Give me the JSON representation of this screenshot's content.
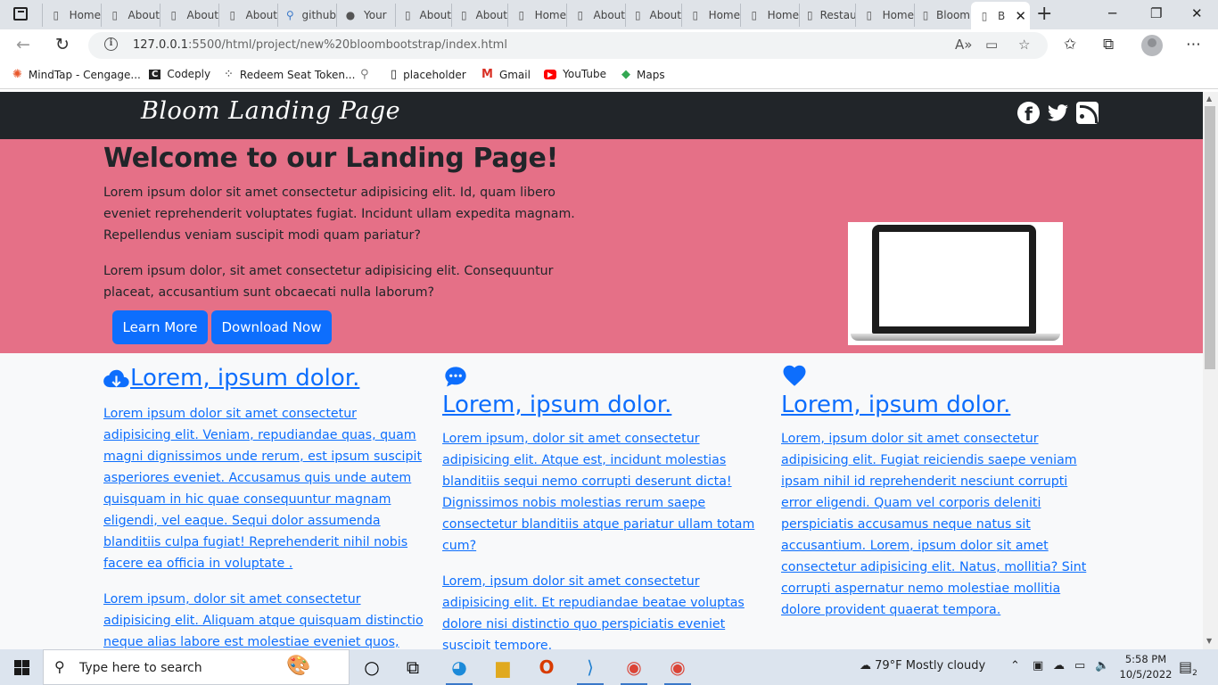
{
  "browser": {
    "tabs": [
      {
        "label": "Home",
        "icon": "page-icon"
      },
      {
        "label": "About",
        "icon": "page-icon"
      },
      {
        "label": "About",
        "icon": "page-icon"
      },
      {
        "label": "About",
        "icon": "page-icon"
      },
      {
        "label": "github",
        "icon": "search-icon"
      },
      {
        "label": "Your",
        "icon": "github-icon"
      },
      {
        "label": "About",
        "icon": "page-icon"
      },
      {
        "label": "About",
        "icon": "page-icon"
      },
      {
        "label": "Home",
        "icon": "page-icon"
      },
      {
        "label": "About",
        "icon": "page-icon"
      },
      {
        "label": "About",
        "icon": "page-icon"
      },
      {
        "label": "Home",
        "icon": "page-icon"
      },
      {
        "label": "Home",
        "icon": "page-icon"
      },
      {
        "label": "Restau",
        "icon": "page-icon"
      },
      {
        "label": "Home",
        "icon": "page-icon"
      },
      {
        "label": "Bloom",
        "icon": "page-icon"
      },
      {
        "label": "B",
        "icon": "page-icon",
        "active": true
      }
    ],
    "url_host": "127.0.0.1",
    "url_path": ":5500/html/project/new%20bloombootstrap/index.html"
  },
  "bookmarks": [
    {
      "label": "MindTap - Cengage...",
      "icon": "mindtap-icon"
    },
    {
      "label": "Codeply",
      "icon": "codeply-icon"
    },
    {
      "label": "Redeem Seat Token...",
      "icon": "dots-icon"
    },
    {
      "label": "",
      "icon": "search-icon"
    },
    {
      "label": "placeholder",
      "icon": "page-icon"
    },
    {
      "label": "Gmail",
      "icon": "gmail-icon"
    },
    {
      "label": "YouTube",
      "icon": "youtube-icon"
    },
    {
      "label": "Maps",
      "icon": "maps-icon"
    }
  ],
  "site": {
    "brand": "Bloom Landing Page",
    "hero": {
      "title": "Welcome to our Landing Page!",
      "paragraph1": "Lorem ipsum dolor sit amet consectetur adipisicing elit. Id, quam libero eveniet reprehenderit voluptates fugiat. Incidunt ullam expedita magnam. Repellendus veniam suscipit modi quam pariatur?",
      "paragraph2": "Lorem ipsum dolor, sit amet consectetur adipisicing elit. Consequuntur placeat, accusantium sunt obcaecati nulla laborum?",
      "learn_more": "Learn More",
      "download_now": "Download Now"
    },
    "features": [
      {
        "icon": "cloud-download-icon",
        "title": "Lorem, ipsum dolor.",
        "paragraphs": [
          "Lorem ipsum dolor sit amet consectetur adipisicing elit. Veniam, repudiandae quas, quam magni dignissimos unde rerum, est ipsum suscipit asperiores eveniet. Accusamus quis unde autem quisquam in hic quae consequuntur magnam eligendi, vel eaque. Sequi dolor assumenda blanditiis culpa fugiat! Reprehenderit nihil nobis facere ea officia in voluptate .",
          "Lorem ipsum, dolor sit amet consectetur adipisicing elit. Aliquam atque quisquam distinctio neque alias labore est molestiae eveniet quos,"
        ]
      },
      {
        "icon": "chat-icon",
        "title": "Lorem, ipsum dolor.",
        "paragraphs": [
          "Lorem ipsum, dolor sit amet consectetur adipisicing elit. Atque est, incidunt molestias blanditiis sequi nemo corrupti deserunt dicta! Dignissimos nobis molestias rerum saepe consectetur blanditiis atque pariatur ullam totam cum?",
          "Lorem, ipsum dolor sit amet consectetur adipisicing elit. Et repudiandae beatae voluptas dolore nisi distinctio quo perspiciatis eveniet suscipit tempore."
        ]
      },
      {
        "icon": "heart-icon",
        "title": "Lorem, ipsum dolor.",
        "paragraphs": [
          "Lorem, ipsum dolor sit amet consectetur adipisicing elit. Fugiat reiciendis saepe veniam ipsam nihil id reprehenderit nesciunt corrupti error eligendi. Quam vel corporis deleniti perspiciatis accusamus neque natus sit accusantium. Lorem, ipsum dolor sit amet consectetur adipisicing elit. Natus, mollitia? Sint corrupti aspernatur nemo molestiae mollitia dolore provident quaerat tempora."
        ]
      }
    ]
  },
  "taskbar": {
    "search_placeholder": "Type here to search",
    "weather": "79°F  Mostly cloudy",
    "time": "5:58 PM",
    "date": "10/5/2022",
    "notifications": "2"
  },
  "colors": {
    "hero_bg": "#e57087",
    "navbar_bg": "#212529",
    "primary": "#0d6efd"
  }
}
